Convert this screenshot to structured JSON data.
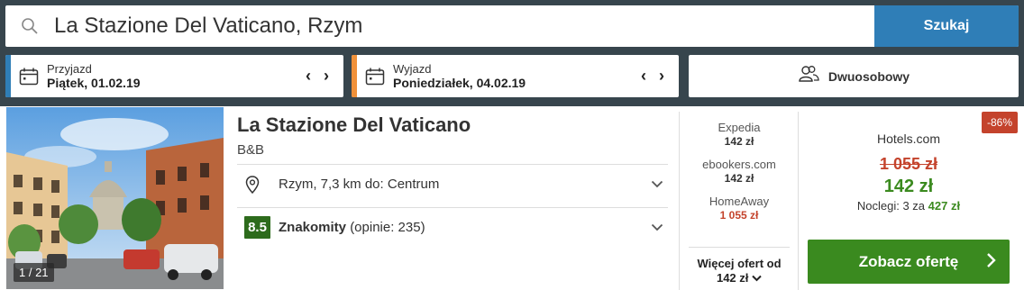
{
  "search": {
    "value": "La Stazione Del Vaticano, Rzym",
    "button_label": "Szukaj"
  },
  "checkin": {
    "label": "Przyjazd",
    "value": "Piątek, 01.02.19",
    "accent": "#2f7eb7"
  },
  "checkout": {
    "label": "Wyjazd",
    "value": "Poniedziałek, 04.02.19",
    "accent": "#f0913a"
  },
  "room": {
    "label": "Dwuosobowy"
  },
  "hotel": {
    "name": "La Stazione Del Vaticano",
    "type": "B&B",
    "location": "Rzym, 7,3 km do: Centrum",
    "rating_score": "8.5",
    "rating_label": "Znakomity",
    "rating_reviews": "(opinie: 235)",
    "photo_counter": "1 / 21"
  },
  "providers": [
    {
      "name": "Expedia",
      "price": "142 zł"
    },
    {
      "name": "ebookers.com",
      "price": "142 zł"
    },
    {
      "name": "HomeAway",
      "price": "1 055 zł"
    }
  ],
  "more_offers": {
    "line1": "Więcej ofert od",
    "line2": "142 zł"
  },
  "best_offer": {
    "discount_badge": "-86%",
    "provider": "Hotels.com",
    "old_price": "1 055 zł",
    "price": "142 zł",
    "nights_text": "Noclegi: 3 za",
    "nights_total": "427 zł",
    "cta_label": "Zobacz ofertę"
  },
  "colors": {
    "header_bg": "#37454d",
    "search_button": "#2f7eb7",
    "cta_green": "#3a8a1f",
    "price_green": "#3b8a1f",
    "price_red": "#c4432c",
    "rating_green": "#2d6b1c"
  }
}
